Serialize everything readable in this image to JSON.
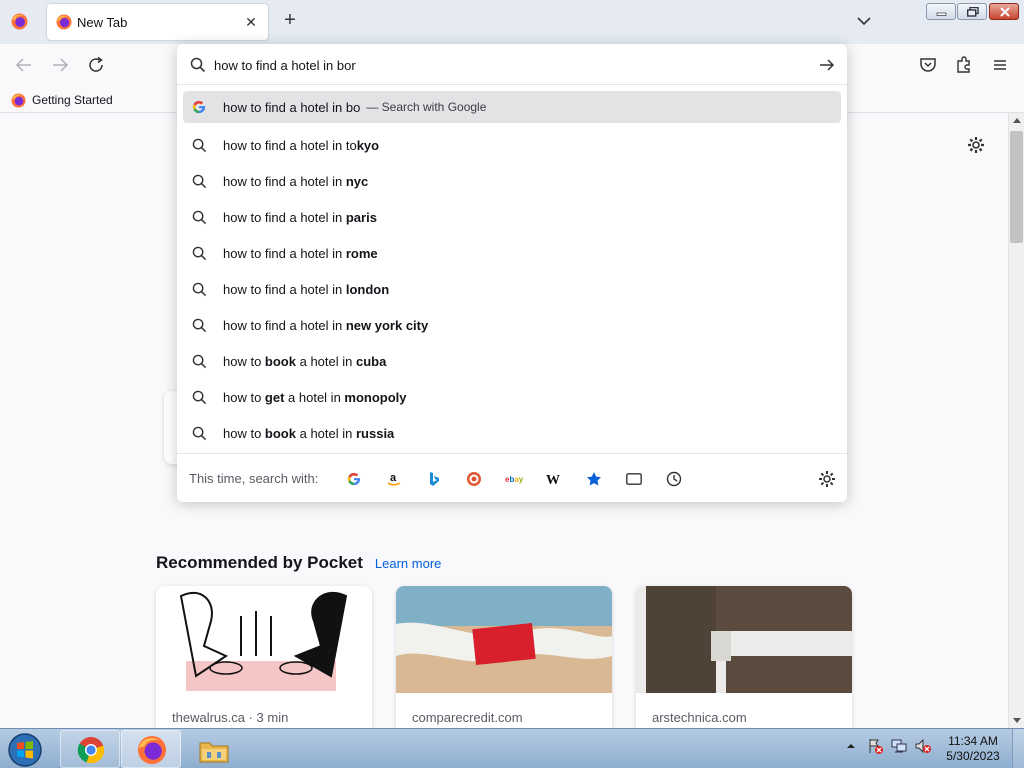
{
  "colors": {
    "accent": "#0061e0",
    "selected_row": "#e3e3e6",
    "tabstrip": "#e6ebf3"
  },
  "tabstrip": {
    "menu_icon": "firefox-icon",
    "tab": {
      "title": "New Tab",
      "favicon": "firefox-icon",
      "close_icon": "close-icon"
    },
    "new_tab_icon": "plus-icon",
    "list_tabs_icon": "chevron-down-icon"
  },
  "window_controls": [
    "minimize-icon",
    "restore-icon",
    "close-icon"
  ],
  "navbar": {
    "buttons": [
      "back-arrow-icon",
      "forward-arrow-icon",
      "reload-icon"
    ],
    "right_buttons": [
      "pocket-icon",
      "extensions-icon",
      "hamburger-menu-icon"
    ]
  },
  "bookmarks": [
    {
      "label": "Getting Started",
      "icon": "firefox-icon"
    }
  ],
  "urlbar": {
    "value": "how to find a hotel in bor",
    "go_icon": "arrow-right-icon",
    "search_icon": "search-icon"
  },
  "suggestions": [
    {
      "icon": "google-icon",
      "parts": [
        {
          "t": "how to find a hotel in bo",
          "b": false
        }
      ],
      "action": "— Search with Google",
      "selected": true
    },
    {
      "icon": "search-icon",
      "parts": [
        {
          "t": "how to find a hotel in to",
          "b": false
        },
        {
          "t": "kyo",
          "b": true
        }
      ]
    },
    {
      "icon": "search-icon",
      "parts": [
        {
          "t": "how to find a hotel in ",
          "b": false
        },
        {
          "t": "nyc",
          "b": true
        }
      ]
    },
    {
      "icon": "search-icon",
      "parts": [
        {
          "t": "how to find a hotel in ",
          "b": false
        },
        {
          "t": "paris",
          "b": true
        }
      ]
    },
    {
      "icon": "search-icon",
      "parts": [
        {
          "t": "how to find a hotel in ",
          "b": false
        },
        {
          "t": "rome",
          "b": true
        }
      ]
    },
    {
      "icon": "search-icon",
      "parts": [
        {
          "t": "how to find a hotel in ",
          "b": false
        },
        {
          "t": "london",
          "b": true
        }
      ]
    },
    {
      "icon": "search-icon",
      "parts": [
        {
          "t": "how to find a hotel in ",
          "b": false
        },
        {
          "t": "new york city",
          "b": true
        }
      ]
    },
    {
      "icon": "search-icon",
      "parts": [
        {
          "t": "how to ",
          "b": false
        },
        {
          "t": "book",
          "b": true
        },
        {
          "t": " a hotel in ",
          "b": false
        },
        {
          "t": "cuba",
          "b": true
        }
      ]
    },
    {
      "icon": "search-icon",
      "parts": [
        {
          "t": "how to ",
          "b": false
        },
        {
          "t": "get",
          "b": true
        },
        {
          "t": " a hotel in ",
          "b": false
        },
        {
          "t": "monopoly",
          "b": true
        }
      ]
    },
    {
      "icon": "search-icon",
      "parts": [
        {
          "t": "how to ",
          "b": false
        },
        {
          "t": "book",
          "b": true
        },
        {
          "t": " a hotel in ",
          "b": false
        },
        {
          "t": "russia",
          "b": true
        }
      ]
    }
  ],
  "oneoff": {
    "label": "This time, search with:",
    "engines": [
      "google-icon",
      "amazon-icon",
      "bing-icon",
      "duckduckgo-icon",
      "ebay-icon",
      "wikipedia-icon",
      "bookmarks-star-icon",
      "tabs-icon",
      "history-clock-icon"
    ],
    "settings_icon": "gear-icon"
  },
  "newtab": {
    "settings_icon": "gear-icon",
    "pocket_title": "Recommended by Pocket",
    "pocket_link": "Learn more",
    "stories": [
      {
        "source": "thewalrus.ca · 3 min"
      },
      {
        "source": "comparecredit.com"
      },
      {
        "source": "arstechnica.com"
      }
    ]
  },
  "taskbar": {
    "apps": [
      "chrome-icon",
      "firefox-icon",
      "file-explorer-icon"
    ],
    "tray": [
      "show-hidden-icons-arrow",
      "action-center-flag-icon",
      "network-icon",
      "volume-muted-icon"
    ],
    "time": "11:34 AM",
    "date": "5/30/2023"
  }
}
